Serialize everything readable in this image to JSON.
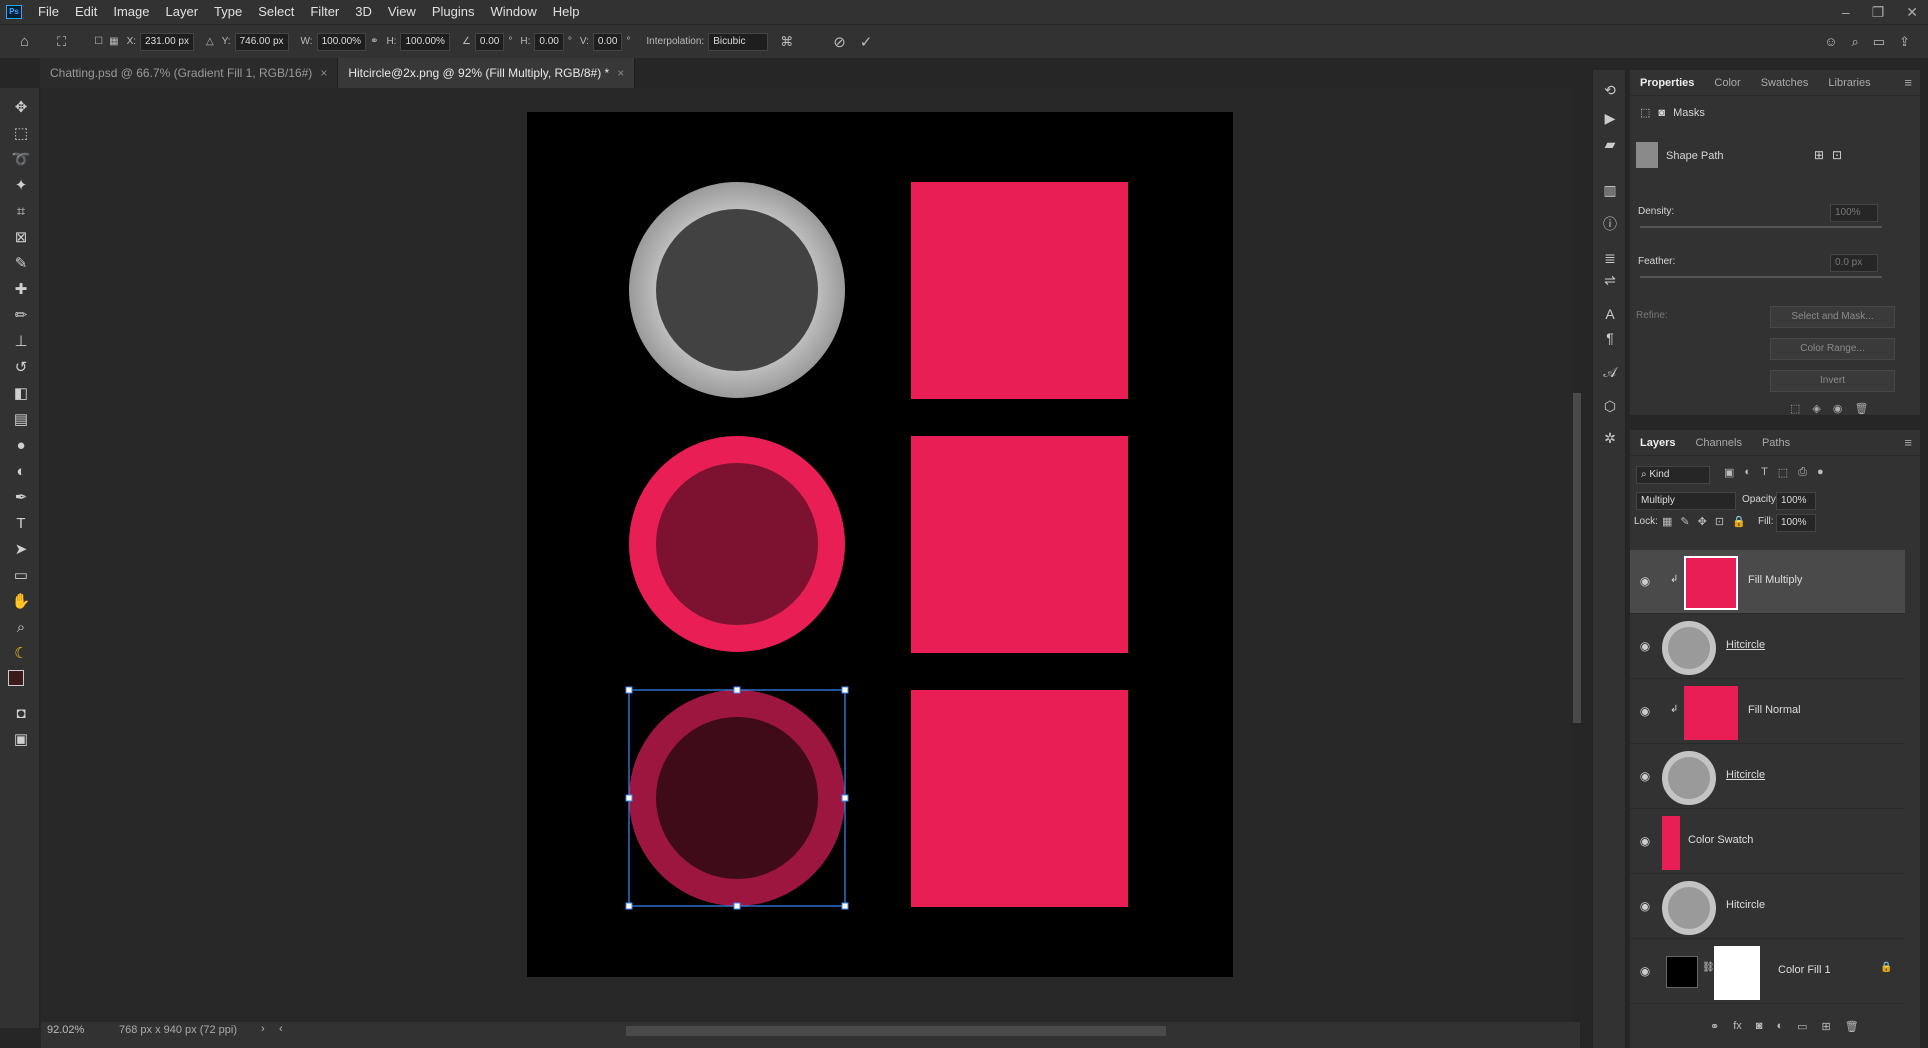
{
  "menubar": {
    "logo": "Ps",
    "items": [
      "File",
      "Edit",
      "Image",
      "Layer",
      "Type",
      "Select",
      "Filter",
      "3D",
      "View",
      "Plugins",
      "Window",
      "Help"
    ]
  },
  "options": {
    "x_label": "X:",
    "x": "231.00 px",
    "y_label": "Y:",
    "y": "746.00 px",
    "w_label": "W:",
    "w": "100.00%",
    "h_label": "H:",
    "h": "100.00%",
    "angle": "0.00",
    "hskew_label": "H:",
    "hskew": "0.00",
    "vskew_label": "V:",
    "vskew": "0.00",
    "interp_label": "Interpolation:",
    "interp": "Bicubic"
  },
  "tabs": [
    {
      "label": "Chatting.psd @ 66.7% (Gradient Fill 1, RGB/16#)",
      "close": "×"
    },
    {
      "label": "Hitcircle@2x.png @ 92% (Fill Multiply, RGB/8#) *",
      "close": "×"
    }
  ],
  "status": {
    "zoom": "92.02%",
    "size": "768 px x 940 px (72 ppi)"
  },
  "colors": {
    "accent": "#e91e55",
    "dark_ring": "#8e1438",
    "inner_multiply": "#3f0b18"
  },
  "properties": {
    "tabs": [
      "Properties",
      "Color",
      "Swatches",
      "Libraries"
    ],
    "section": "Masks",
    "shape_path": "Shape Path",
    "density_label": "Density:",
    "density": "100%",
    "feather_label": "Feather:",
    "feather": "0.0 px",
    "refine_label": "Refine:",
    "buttons": [
      "Select and Mask...",
      "Color Range...",
      "Invert"
    ]
  },
  "layers_panel": {
    "tabs": [
      "Layers",
      "Channels",
      "Paths"
    ],
    "kind": "Kind",
    "blend": "Multiply",
    "opacity_label": "Opacity:",
    "opacity": "100%",
    "lock_label": "Lock:",
    "fill_label": "Fill:",
    "fill": "100%",
    "rows": [
      {
        "name": "Fill Multiply"
      },
      {
        "name": "Hitcircle"
      },
      {
        "name": "Fill Normal"
      },
      {
        "name": "Hitcircle"
      },
      {
        "name": "Color Swatch"
      },
      {
        "name": "Hitcircle"
      },
      {
        "name": "Color Fill 1"
      }
    ]
  }
}
